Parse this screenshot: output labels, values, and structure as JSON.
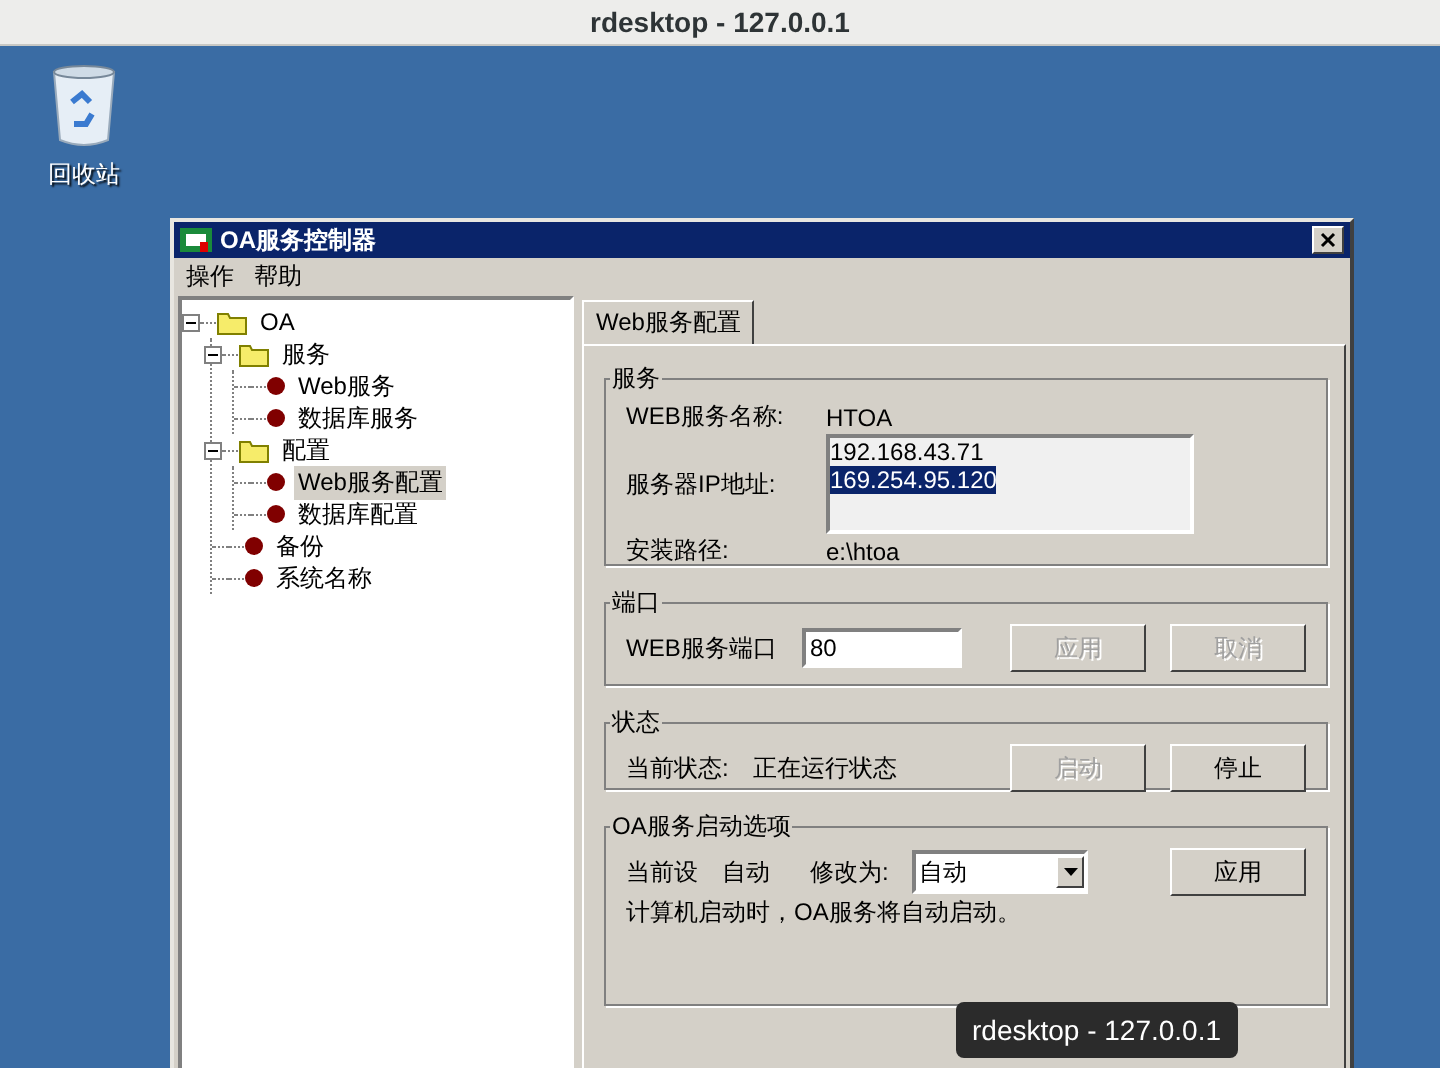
{
  "screen_title": "rdesktop - 127.0.0.1",
  "desktop_icons": [
    {
      "label": "回收站"
    }
  ],
  "window": {
    "title": "OA服务控制器",
    "menu": [
      "操作",
      "帮助"
    ]
  },
  "tree": [
    {
      "label": "OA",
      "kind": "folder",
      "expanded": true,
      "selected": false,
      "children": [
        {
          "label": "服务",
          "kind": "folder",
          "expanded": true,
          "selected": false,
          "children": [
            {
              "label": "Web服务",
              "kind": "bullet",
              "selected": false
            },
            {
              "label": "数据库服务",
              "kind": "bullet",
              "selected": false
            }
          ]
        },
        {
          "label": "配置",
          "kind": "folder",
          "expanded": true,
          "selected": false,
          "children": [
            {
              "label": "Web服务配置",
              "kind": "bullet",
              "selected": true
            },
            {
              "label": "数据库配置",
              "kind": "bullet",
              "selected": false
            }
          ]
        },
        {
          "label": "备份",
          "kind": "bullet",
          "selected": false
        },
        {
          "label": "系统名称",
          "kind": "bullet",
          "selected": false
        }
      ]
    }
  ],
  "tabs": [
    {
      "label": "Web服务配置",
      "selected": true
    }
  ],
  "service_group": {
    "title": "服务",
    "name_label": "WEB服务名称:",
    "name_value": "HTOA",
    "ip_label": "服务器IP地址:",
    "ip_list": [
      {
        "text": "192.168.43.71",
        "selected": false
      },
      {
        "text": "169.254.95.120",
        "selected": true
      }
    ],
    "path_label": "安装路径:",
    "path_value": "e:\\htoa"
  },
  "port_group": {
    "title": "端口",
    "label": "WEB服务端口",
    "value": "80",
    "buttons": [
      {
        "label": "应用",
        "disabled": true
      },
      {
        "label": "取消",
        "disabled": true
      }
    ]
  },
  "status_group": {
    "title": "状态",
    "label": "当前状态:",
    "value": "正在运行状态",
    "buttons": [
      {
        "label": "启动",
        "disabled": true
      },
      {
        "label": "停止",
        "disabled": false
      }
    ]
  },
  "startup_group": {
    "title": "OA服务启动选项",
    "current_label": "当前设",
    "current_value": "自动",
    "change_label": "修改为:",
    "select_value": "自动",
    "button": {
      "label": "应用",
      "disabled": false
    },
    "note": "计算机启动时，OA服务将自动启动。"
  },
  "tooltip": "rdesktop - 127.0.0.1"
}
